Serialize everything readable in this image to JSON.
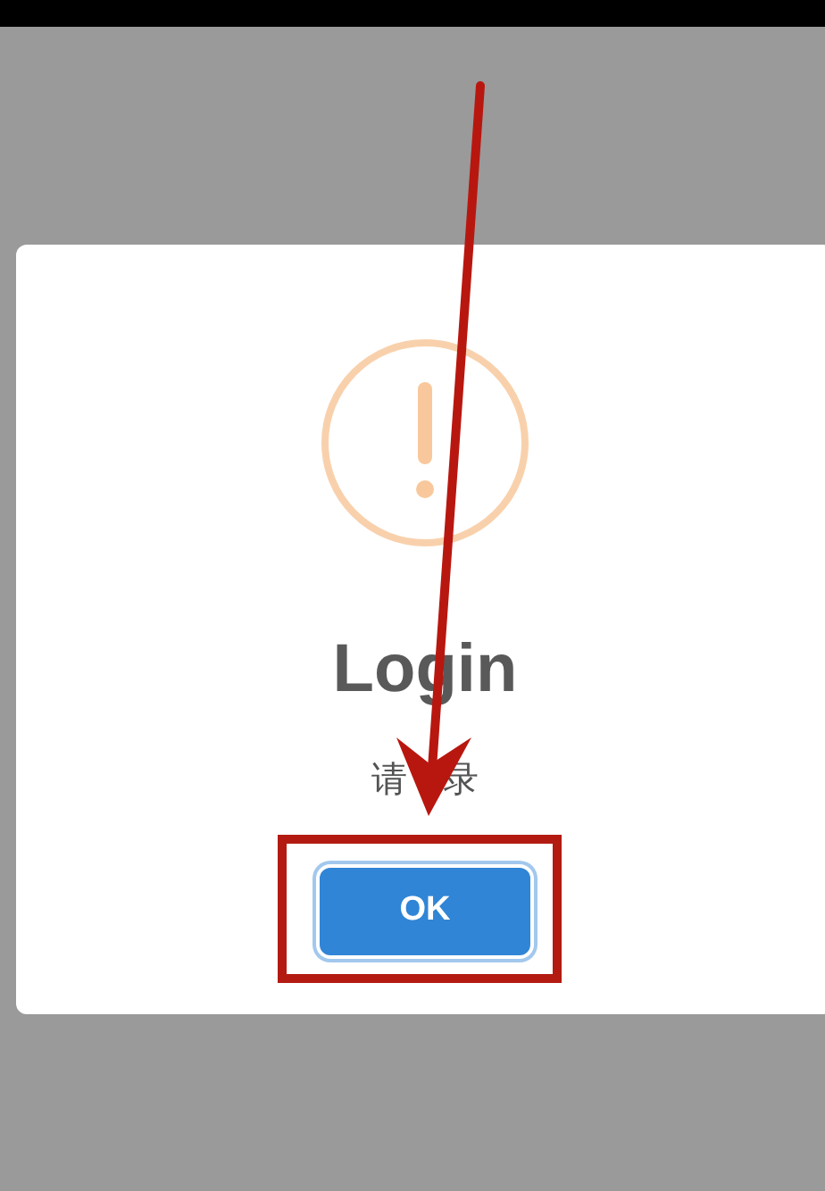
{
  "dialog": {
    "title": "Login",
    "message_visible_parts": [
      "请",
      "录"
    ],
    "buttons": [
      {
        "label": "OK",
        "focused": true
      }
    ]
  },
  "annotation_arrow": true,
  "highlight_box": true
}
